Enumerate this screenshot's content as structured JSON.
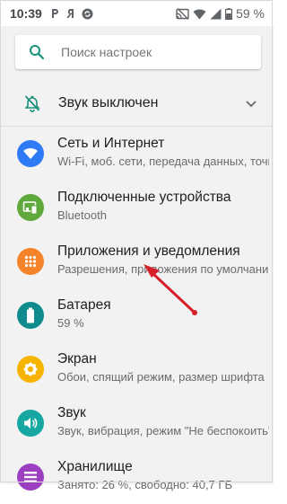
{
  "status_bar": {
    "time": "10:39",
    "battery_percent": "59 %"
  },
  "search": {
    "placeholder": "Поиск настроек"
  },
  "dnd": {
    "label": "Звук выключен"
  },
  "settings": [
    {
      "title": "Сеть и Интернет",
      "subtitle": "Wi-Fi, моб. сети, передача данных, точка доступа",
      "color": "#2f7bf5",
      "icon": "wifi-icon"
    },
    {
      "title": "Подключенные устройства",
      "subtitle": "Bluetooth",
      "color": "#5fa83c",
      "icon": "devices-icon"
    },
    {
      "title": "Приложения и уведомления",
      "subtitle": "Разрешения, приложения по умолчанию",
      "color": "#f5832a",
      "icon": "apps-icon"
    },
    {
      "title": "Батарея",
      "subtitle": "59 %",
      "color": "#0f8b8d",
      "icon": "battery-icon"
    },
    {
      "title": "Экран",
      "subtitle": "Обои, спящий режим, размер шрифта",
      "color": "#f6b400",
      "icon": "display-icon"
    },
    {
      "title": "Звук",
      "subtitle": "Звук, вибрация, режим \"Не беспокоить\"",
      "color": "#17a7a3",
      "icon": "sound-icon"
    },
    {
      "title": "Хранилище",
      "subtitle": "Занято: 26 %, свободно: 40,7 ГБ",
      "color": "#9c3fc1",
      "icon": "storage-icon"
    }
  ],
  "annotation_color": "#d6202a"
}
